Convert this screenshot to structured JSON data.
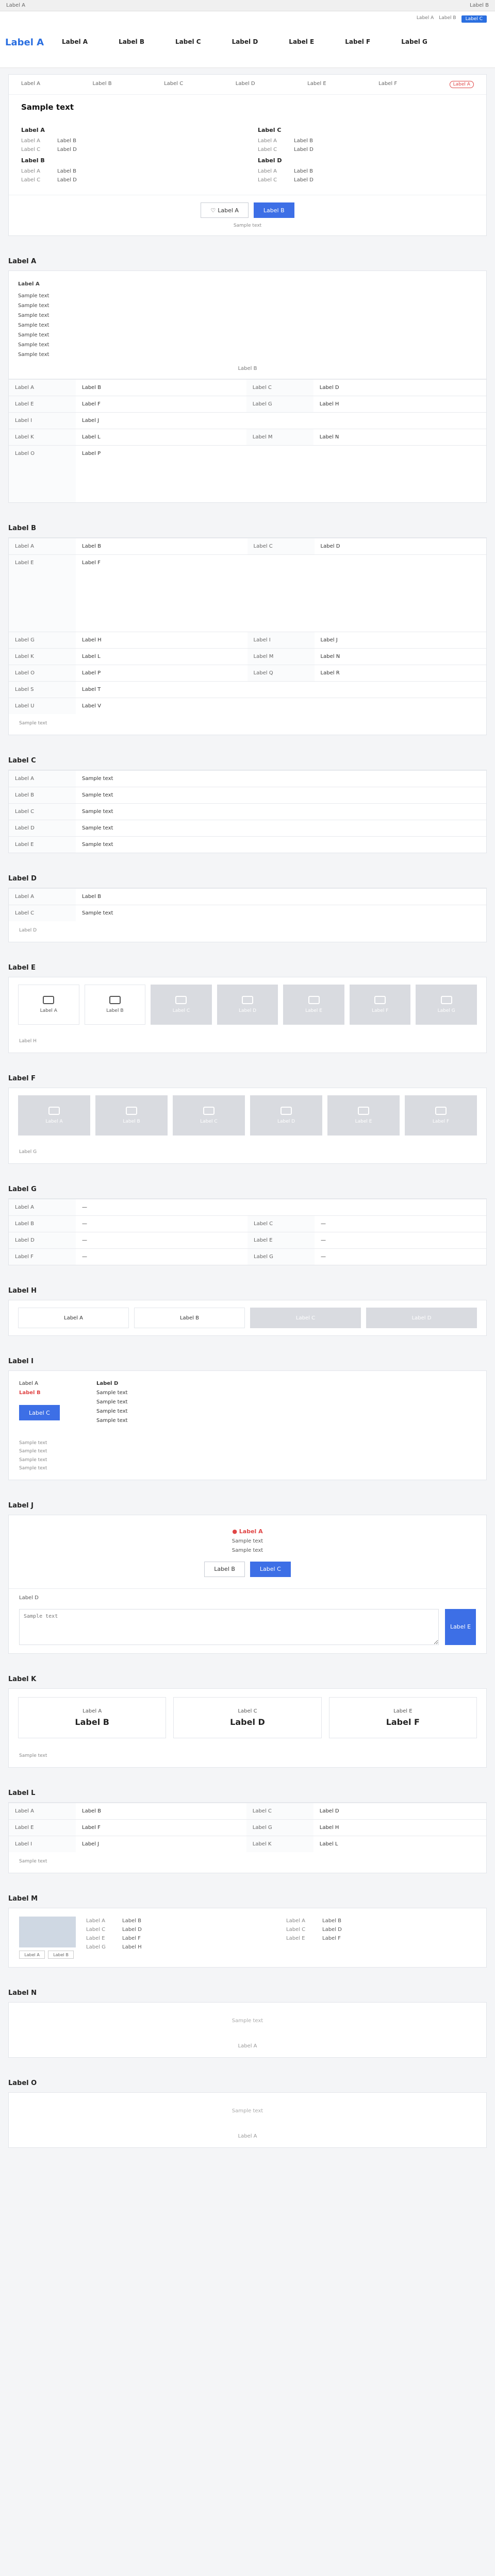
{
  "topbar": {
    "left": "Label A",
    "right": "Label B"
  },
  "header": {
    "logo": "Label A",
    "utility": [
      "Label A",
      "Label B",
      "Label C"
    ],
    "nav": [
      "Label A",
      "Label B",
      "Label C",
      "Label D",
      "Label E",
      "Label F",
      "Label G"
    ]
  },
  "job": {
    "tabs": [
      "Label A",
      "Label B",
      "Label C",
      "Label D",
      "Label E",
      "Label F"
    ],
    "badge": "Label A",
    "title": "Sample text",
    "left_title": "Label A",
    "left_rows": [
      {
        "k": "Label A",
        "v": "Label B"
      },
      {
        "k": "Label C",
        "v": "Label D"
      }
    ],
    "left_title2": "Label B",
    "left_rows2": [
      {
        "k": "Label A",
        "v": "Label B"
      },
      {
        "k": "Label C",
        "v": "Label D"
      }
    ],
    "right_title": "Label C",
    "right_rows": [
      {
        "k": "Label A",
        "v": "Label B"
      },
      {
        "k": "Label C",
        "v": "Label D"
      }
    ],
    "right_title2": "Label D",
    "right_rows2": [
      {
        "k": "Label A",
        "v": "Label B"
      },
      {
        "k": "Label C",
        "v": "Label D"
      }
    ],
    "btn_scrap": "Label A",
    "btn_apply": "Label B",
    "note": "Sample text"
  },
  "sections": {
    "conditions": "Label A",
    "workcond": "Label B",
    "welfare": "Label C",
    "other": "Label D",
    "benefits": "Label E",
    "disabled": "Label F",
    "env": "Label G",
    "method": "Label H",
    "apply": "Label I",
    "contact": "Label J",
    "stats": "Label K",
    "recruiter": "Label L",
    "company": "Label M",
    "related": "Label N",
    "similar": "Label O"
  },
  "conditions": {
    "desc_title": "Label A",
    "desc_lines": [
      "Sample text",
      "Sample text",
      "Sample text",
      "Sample text",
      "Sample text",
      "Sample text",
      "Sample text"
    ],
    "more": "Label B",
    "rows": [
      {
        "h": "Label A",
        "v": "Label B",
        "h2": "Label C",
        "v2": "Label D"
      },
      {
        "h": "Label E",
        "v": "Label F",
        "h2": "Label G",
        "v2": "Label H"
      },
      {
        "h": "Label I",
        "v": "Label J",
        "h2": "",
        "v2": ""
      },
      {
        "h": "Label K",
        "v": "Label L",
        "h2": "Label M",
        "v2": "Label N"
      },
      {
        "h": "Label O",
        "v": "Label P",
        "h2": "",
        "v2": ""
      }
    ]
  },
  "workcond": {
    "rows": [
      {
        "h": "Label A",
        "v": "Label B",
        "h2": "Label C",
        "v2": "Label D"
      },
      {
        "h": "Label E",
        "v": "Label F",
        "h2": "",
        "v2": ""
      },
      {
        "h": "Label G",
        "v": "Label H",
        "h2": "Label I",
        "v2": "Label J"
      },
      {
        "h": "Label K",
        "v": "Label L",
        "h2": "Label M",
        "v2": "Label N"
      },
      {
        "h": "Label O",
        "v": "Label P",
        "h2": "Label Q",
        "v2": "Label R"
      },
      {
        "h": "Label S",
        "v": "Label T",
        "h2": "",
        "v2": ""
      },
      {
        "h": "Label U",
        "v": "Label V",
        "h2": "",
        "v2": ""
      }
    ],
    "footnote": "Sample text"
  },
  "welfare": {
    "rows": [
      {
        "h": "Label A",
        "v": "Sample text"
      },
      {
        "h": "Label B",
        "v": "Sample text"
      },
      {
        "h": "Label C",
        "v": "Sample text"
      },
      {
        "h": "Label D",
        "v": "Sample text"
      },
      {
        "h": "Label E",
        "v": "Sample text"
      }
    ]
  },
  "other": {
    "rows": [
      {
        "h": "Label A",
        "v": "Label B"
      },
      {
        "h": "Label C",
        "v": "Sample text"
      }
    ],
    "sub": "Label D"
  },
  "benefits": {
    "tiles": [
      {
        "label": "Label A",
        "dim": false
      },
      {
        "label": "Label B",
        "dim": false
      },
      {
        "label": "Label C",
        "dim": true
      },
      {
        "label": "Label D",
        "dim": true
      },
      {
        "label": "Label E",
        "dim": true
      },
      {
        "label": "Label F",
        "dim": true
      },
      {
        "label": "Label G",
        "dim": true
      }
    ],
    "sub": "Label H"
  },
  "disabled": {
    "tiles": [
      {
        "label": "Label A",
        "dim": true
      },
      {
        "label": "Label B",
        "dim": true
      },
      {
        "label": "Label C",
        "dim": true
      },
      {
        "label": "Label D",
        "dim": true
      },
      {
        "label": "Label E",
        "dim": true
      },
      {
        "label": "Label F",
        "dim": true
      }
    ],
    "sub": "Label G"
  },
  "env": {
    "rows": [
      {
        "h": "Label A",
        "v": "—",
        "h2": "",
        "v2": ""
      },
      {
        "h": "Label B",
        "v": "—",
        "h2": "Label C",
        "v2": "—"
      },
      {
        "h": "Label D",
        "v": "—",
        "h2": "Label E",
        "v2": "—"
      },
      {
        "h": "Label F",
        "v": "—",
        "h2": "Label G",
        "v2": "—"
      }
    ]
  },
  "method": {
    "items": [
      {
        "label": "Label A",
        "dim": false
      },
      {
        "label": "Label B",
        "dim": false
      },
      {
        "label": "Label C",
        "dim": true
      },
      {
        "label": "Label D",
        "dim": true
      }
    ]
  },
  "apply": {
    "l1": "Label A",
    "l2": "Label B",
    "btn": "Label C",
    "r1": "Label D",
    "r_lines": [
      "Sample text",
      "Sample text",
      "Sample text",
      "Sample text"
    ],
    "bullets": [
      "Sample text",
      "Sample text",
      "Sample text",
      "Sample text"
    ]
  },
  "contact": {
    "alert": "Label A",
    "lines": [
      "Sample text",
      "Sample text"
    ],
    "btn1": "Label B",
    "btn2": "Label C",
    "qa_label": "Label D",
    "qa_placeholder": "Sample text",
    "qa_send": "Label E"
  },
  "stats": {
    "items": [
      {
        "label": "Label A",
        "value": "Label B"
      },
      {
        "label": "Label C",
        "value": "Label D"
      },
      {
        "label": "Label E",
        "value": "Label F"
      }
    ],
    "note": "Sample text"
  },
  "recruiter": {
    "rows": [
      {
        "h": "Label A",
        "v": "Label B",
        "h2": "Label C",
        "v2": "Label D"
      },
      {
        "h": "Label E",
        "v": "Label F",
        "h2": "Label G",
        "v2": "Label H"
      },
      {
        "h": "Label I",
        "v": "Label J",
        "h2": "Label K",
        "v2": "Label L"
      }
    ],
    "footnote": "Sample text"
  },
  "company": {
    "thumbs": [
      "Label A",
      "Label B"
    ],
    "rows": [
      {
        "k": "Label A",
        "v": "Label B"
      },
      {
        "k": "Label C",
        "v": "Label D"
      },
      {
        "k": "Label E",
        "v": "Label F"
      },
      {
        "k": "Label G",
        "v": "Label H"
      }
    ],
    "rows2": [
      {
        "k": "Label A",
        "v": "Label B"
      },
      {
        "k": "Label C",
        "v": "Label D"
      },
      {
        "k": "Label E",
        "v": "Label F"
      }
    ]
  },
  "related": {
    "empty": "Sample text",
    "pager": "Label A"
  },
  "similar": {
    "empty": "Sample text",
    "pager": "Label A"
  }
}
